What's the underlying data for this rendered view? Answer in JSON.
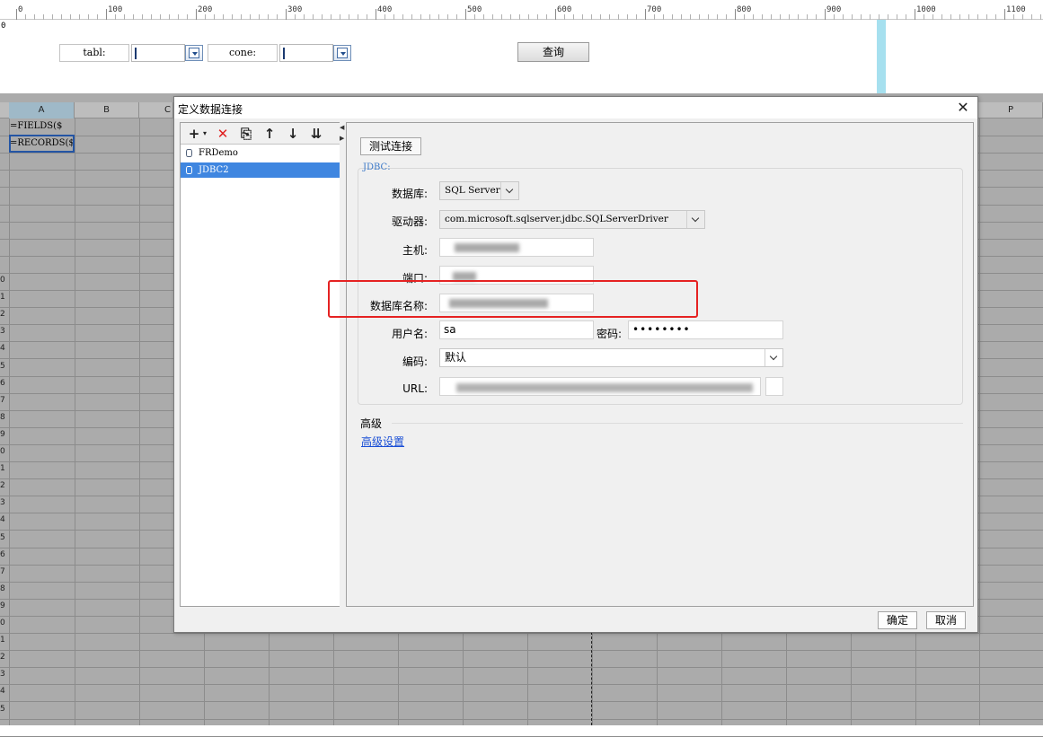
{
  "ruler": {
    "labels": [
      "0",
      "100",
      "200",
      "300",
      "400",
      "500",
      "600",
      "700",
      "800",
      "900",
      "1000",
      "1100"
    ],
    "vertical_label": "0"
  },
  "params": {
    "param1_label": "tabl:",
    "param2_label": "cone:",
    "query_button": "查询"
  },
  "sheet": {
    "columns": [
      "A",
      "B",
      "C",
      "P"
    ],
    "selected_column": "A",
    "cells": {
      "a1": "=FIELDS($",
      "a2": "=RECORDS($"
    },
    "row_numbers": [
      "0",
      "1",
      "2",
      "3",
      "4",
      "5",
      "6",
      "7",
      "8",
      "9",
      "0",
      "1",
      "2",
      "3",
      "4",
      "5",
      "6",
      "7",
      "8",
      "9",
      "0",
      "1",
      "2",
      "3",
      "4",
      "5"
    ]
  },
  "dialog": {
    "title": "定义数据连接",
    "close_icon": "close-icon",
    "toolbar": {
      "add": "+",
      "delete": "✕",
      "copy": "⎘",
      "up": "↑",
      "down": "↓",
      "sort": "⇊"
    },
    "connections": [
      {
        "name": "FRDemo",
        "selected": false
      },
      {
        "name": "JDBC2",
        "selected": true
      }
    ],
    "test_button": "测试连接",
    "group_legend": "JDBC:",
    "fields": {
      "database_label": "数据库:",
      "database_value": "SQL Server",
      "driver_label": "驱动器:",
      "driver_value": "com.microsoft.sqlserver.jdbc.SQLServerDriver",
      "host_label": "主机:",
      "port_label": "端口:",
      "dbname_label": "数据库名称:",
      "user_label": "用户名:",
      "user_value": "sa",
      "password_label": "密码:",
      "password_value": "••••••••",
      "encoding_label": "编码:",
      "encoding_value": "默认",
      "url_label": "URL:"
    },
    "advanced_title": "高级",
    "advanced_link": "高级设置",
    "ok_button": "确定",
    "cancel_button": "取消"
  },
  "colors": {
    "accent_select": "#3f86e0",
    "highlight_box": "#e52222",
    "link": "#1a4fd6"
  }
}
